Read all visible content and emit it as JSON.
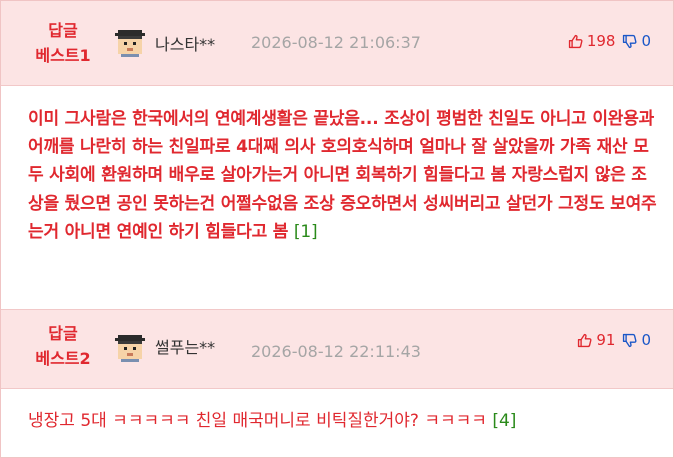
{
  "comments": [
    {
      "rank_label_line1": "답글",
      "rank_label_line2": "베스트1",
      "nickname": "나스타**",
      "date": "2026-08-12 21:06:37",
      "upvotes": "198",
      "downvotes": "0",
      "text": "이미 그사람은 한국에서의 연예계생활은 끝났음... 조상이 평범한 친일도 아니고 이완용과 어깨를 나란히 하는 친일파로 4대째 의사 호의호식하며 얼마나 잘 살았을까 가족 재산 모두 사회에 환원하며 배우로 살아가는거 아니면 회복하기 힘들다고 봄 자랑스럽지 않은 조상을 뒀으면 공인 못하는건 어쩔수없음 조상 증오하면서 성씨버리고 살던가 그정도 보여주는거 아니면 연예인 하기 힘들다고 봄",
      "ref": "[1]"
    },
    {
      "rank_label_line1": "답글",
      "rank_label_line2": "베스트2",
      "nickname": "썰푸는**",
      "date": "2026-08-12 22:11:43",
      "upvotes": "91",
      "downvotes": "0",
      "text": "냉장고 5대 ㅋㅋㅋㅋㅋ 친일 매국머니로 비틱질한거야? ㅋㅋㅋㅋ",
      "ref": "[4]"
    }
  ],
  "colors": {
    "accent_red": "#e0282f",
    "header_bg": "#fce4e4",
    "down_blue": "#1a57c8",
    "ref_green": "#2a8a1a"
  },
  "icons": {
    "avatar": "pixel-avatar-icon",
    "up": "thumbs-up-icon",
    "down": "thumbs-down-icon"
  }
}
